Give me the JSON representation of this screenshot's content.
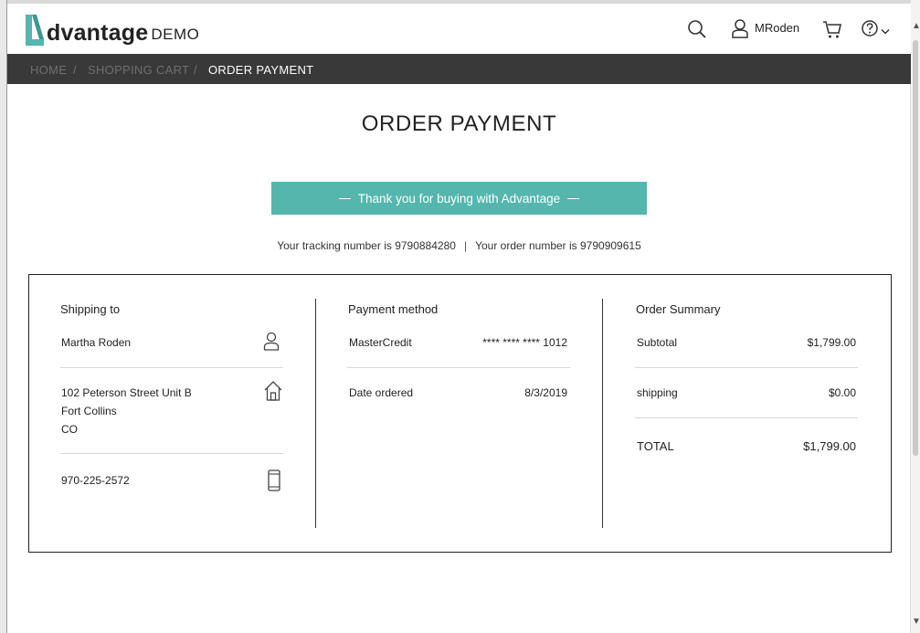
{
  "header": {
    "logo": {
      "word": "dvantage",
      "suffix": "DEMO"
    },
    "user_name": "MRoden",
    "icons": [
      "search-icon",
      "user-icon",
      "cart-icon",
      "help-icon",
      "chevron-down-icon"
    ]
  },
  "breadcrumb": {
    "home": "HOME",
    "cart": "SHOPPING CART",
    "current": "ORDER PAYMENT",
    "separator": "/"
  },
  "page_title": "ORDER PAYMENT",
  "thanks_message": "Thank you for buying with Advantage",
  "tracking": {
    "tracking_text": "Your tracking number is 9790884280",
    "separator": "|",
    "order_text": "Your order number is 9790909615"
  },
  "shipping": {
    "heading": "Shipping to",
    "name": "Martha Roden",
    "address_line1": "102 Peterson Street Unit B",
    "address_line2": "Fort Collins",
    "address_line3": "CO",
    "phone": "970-225-2572"
  },
  "payment": {
    "heading": "Payment method",
    "method_label": "MasterCredit",
    "card_number": "**** **** **** 1012",
    "date_label": "Date ordered",
    "date_value": "8/3/2019"
  },
  "order_summary": {
    "heading": "Order Summary",
    "subtotal_label": "Subtotal",
    "subtotal_value": "$1,799.00",
    "shipping_label": "shipping",
    "shipping_value": "$0.00",
    "total_label": "TOTAL",
    "total_value": "$1,799.00"
  },
  "colors": {
    "accent": "#54b6ad",
    "breadcrumb_bg": "#393939",
    "breadcrumb_link": "#6f6f6f"
  }
}
